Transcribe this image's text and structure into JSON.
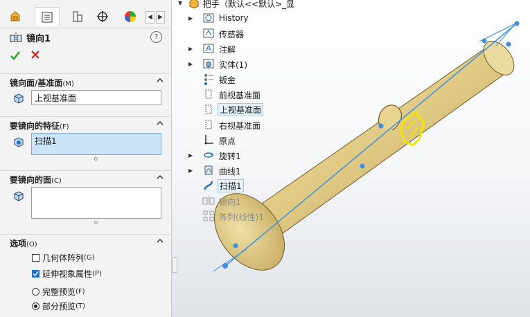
{
  "property_manager": {
    "title": "镜向1",
    "help": "?",
    "ok_icon": "check-icon",
    "cancel_icon": "cross-icon",
    "tabs": [
      "feature-manager-icon",
      "property-manager-icon",
      "configuration-manager-icon",
      "dimxpert-icon",
      "display-manager-icon"
    ],
    "sections": {
      "mirror_plane": {
        "label": "镜向面/基准面",
        "accel": "(M)",
        "value": "上视基准面"
      },
      "features": {
        "label": "要镜向的特征",
        "accel": "(F)",
        "value": "扫描1"
      },
      "faces": {
        "label": "要镜向的面",
        "accel": "(C)",
        "value": ""
      },
      "options": {
        "label": "选项",
        "accel": "(O)",
        "geometry_pattern": {
          "label": "几何体阵列",
          "accel": "(G)",
          "checked": false
        },
        "propagate_visual": {
          "label": "延伸视象属性",
          "accel": "(P)",
          "checked": true
        },
        "full_preview": {
          "label": "完整预览",
          "accel": "(F)",
          "selected": false
        },
        "partial_preview": {
          "label": "部分预览",
          "accel": "(T)",
          "selected": true
        }
      }
    }
  },
  "tree": {
    "root": "把手（默认<<默认>_显",
    "items": [
      {
        "label": "History",
        "icon": "history-icon",
        "expandable": true
      },
      {
        "label": "传感器",
        "icon": "sensor-icon",
        "expandable": false
      },
      {
        "label": "注解",
        "icon": "annotation-icon",
        "expandable": true
      },
      {
        "label": "实体(1)",
        "icon": "solid-body-icon",
        "expandable": true
      },
      {
        "label": "钣金",
        "icon": "sheet-metal-icon",
        "expandable": false
      },
      {
        "label": "前视基准面",
        "icon": "plane-icon",
        "expandable": false
      },
      {
        "label": "上视基准面",
        "icon": "plane-icon",
        "expandable": false,
        "highlighted": true
      },
      {
        "label": "右视基准面",
        "icon": "plane-icon",
        "expandable": false
      },
      {
        "label": "原点",
        "icon": "origin-icon",
        "expandable": false
      },
      {
        "label": "旋转1",
        "icon": "revolve-icon",
        "expandable": true
      },
      {
        "label": "曲线1",
        "icon": "curve-icon",
        "expandable": true
      },
      {
        "label": "扫描1",
        "icon": "sweep-icon",
        "expandable": false,
        "highlighted": true
      },
      {
        "label": "镜向1",
        "icon": "mirror-icon",
        "expandable": false,
        "dim": true
      },
      {
        "label": "阵列(线性)1",
        "icon": "linear-pattern-icon",
        "expandable": false,
        "dim": true
      }
    ]
  },
  "colors": {
    "accent": "#1e6ec9",
    "part": "#e3d08a",
    "preview": "#f2e600",
    "axis": "#3f8fe0"
  }
}
